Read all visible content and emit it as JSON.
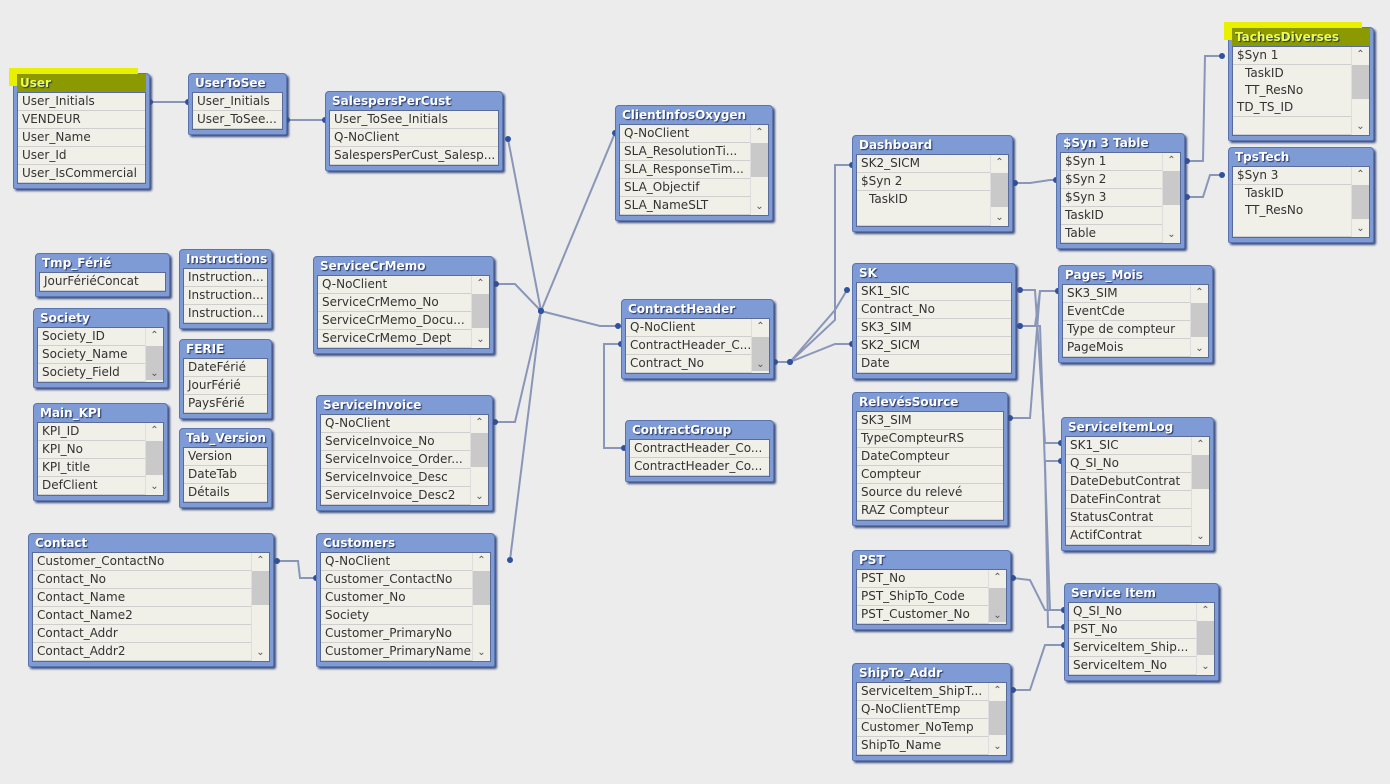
{
  "colors": {
    "header": "#7f9bd6",
    "highlight": "#e8f000",
    "link": "#8a96b8",
    "dot": "#3050a0"
  },
  "tables": [
    {
      "name": "User",
      "highlighted": true,
      "scroll": false,
      "fields": [
        "User_Initials",
        "VENDEUR",
        "User_Name",
        "User_Id",
        "User_IsCommercial"
      ]
    },
    {
      "name": "UserToSee",
      "scroll": false,
      "fields": [
        "User_Initials",
        "User_ToSee..."
      ]
    },
    {
      "name": "SalespersPerCust",
      "scroll": false,
      "fields": [
        "User_ToSee_Initials",
        "Q-NoClient",
        "SalespersPerCust_Salesp..."
      ]
    },
    {
      "name": "ClientInfosOxygen",
      "scroll": true,
      "fields": [
        "Q-NoClient",
        "SLA_ResolutionTi...",
        "SLA_ResponseTim...",
        "SLA_Objectif",
        "SLA_NameSLT"
      ]
    },
    {
      "name": "Dashboard",
      "scroll": true,
      "fields": [
        "SK2_SICM",
        "$Syn 2",
        "  TaskID",
        ""
      ]
    },
    {
      "name": "$Syn 3 Table",
      "scroll": true,
      "fields": [
        "$Syn 1",
        "$Syn 2",
        "$Syn 3",
        "TaskID",
        "Table"
      ]
    },
    {
      "name": "TachesDiverses",
      "highlighted": true,
      "scroll": true,
      "fields": [
        "$Syn 1",
        "  TaskID",
        "  TT_ResNo",
        "TD_TS_ID",
        ""
      ]
    },
    {
      "name": "TpsTech",
      "scroll": true,
      "fields": [
        "$Syn 3",
        "  TaskID",
        "  TT_ResNo",
        ""
      ]
    },
    {
      "name": "Tmp_Férié",
      "scroll": false,
      "fields": [
        "JourFériéConcat"
      ]
    },
    {
      "name": "Instructions",
      "scroll": false,
      "fields": [
        "Instruction...",
        "Instruction...",
        "Instruction..."
      ]
    },
    {
      "name": "Society",
      "scroll": true,
      "fields": [
        "Society_ID",
        "Society_Name",
        "Society_Field"
      ]
    },
    {
      "name": "FERIE",
      "scroll": false,
      "fields": [
        "DateFérié",
        "JourFérié",
        "PaysFérié"
      ]
    },
    {
      "name": "Main_KPI",
      "scroll": true,
      "fields": [
        "KPI_ID",
        "KPI_No",
        "KPI_title",
        "DefClient"
      ]
    },
    {
      "name": "Tab_Version",
      "scroll": false,
      "fields": [
        "Version",
        "DateTab",
        "Détails"
      ]
    },
    {
      "name": "Contact",
      "scroll": true,
      "fields": [
        "Customer_ContactNo",
        "Contact_No",
        "Contact_Name",
        "Contact_Name2",
        "Contact_Addr",
        "Contact_Addr2"
      ]
    },
    {
      "name": "ServiceCrMemo",
      "scroll": true,
      "fields": [
        "Q-NoClient",
        "ServiceCrMemo_No",
        "ServiceCrMemo_Docu...",
        "ServiceCrMemo_Dept"
      ]
    },
    {
      "name": "ServiceInvoice",
      "scroll": true,
      "fields": [
        "Q-NoClient",
        "ServiceInvoice_No",
        "ServiceInvoice_Order...",
        "ServiceInvoice_Desc",
        "ServiceInvoice_Desc2"
      ]
    },
    {
      "name": "Customers",
      "scroll": true,
      "fields": [
        "Q-NoClient",
        "Customer_ContactNo",
        "Customer_No",
        "Society",
        "Customer_PrimaryNo",
        "Customer_PrimaryName"
      ]
    },
    {
      "name": "ContractHeader",
      "scroll": true,
      "fields": [
        "Q-NoClient",
        "ContractHeader_C...",
        "Contract_No"
      ]
    },
    {
      "name": "ContractGroup",
      "scroll": false,
      "fields": [
        "ContractHeader_Co...",
        "ContractHeader_Co..."
      ]
    },
    {
      "name": "SK",
      "scroll": false,
      "fields": [
        "SK1_SIC",
        "Contract_No",
        "SK3_SIM",
        "SK2_SICM",
        "Date"
      ]
    },
    {
      "name": "RelevésSource",
      "scroll": false,
      "fields": [
        "SK3_SIM",
        "TypeCompteurRS",
        "DateCompteur",
        "Compteur",
        "Source du relevé",
        "RAZ Compteur"
      ]
    },
    {
      "name": "Pages_Mois",
      "scroll": true,
      "fields": [
        "SK3_SIM",
        "EventCde",
        "Type de compteur",
        "PageMois"
      ]
    },
    {
      "name": "ServiceItemLog",
      "scroll": true,
      "fields": [
        "SK1_SIC",
        "Q_SI_No",
        "DateDebutContrat",
        "DateFinContrat",
        "StatusContrat",
        "ActifContrat"
      ]
    },
    {
      "name": "PST",
      "scroll": true,
      "fields": [
        "PST_No",
        "PST_ShipTo_Code",
        "PST_Customer_No"
      ]
    },
    {
      "name": "Service Item",
      "scroll": true,
      "fields": [
        "Q_SI_No",
        "PST_No",
        "ServiceItem_Ship...",
        "ServiceItem_No"
      ]
    },
    {
      "name": "ShipTo_Addr",
      "scroll": true,
      "fields": [
        "ServiceItem_ShipT...",
        "Q-NoClientTEmp",
        "Customer_NoTemp",
        "ShipTo_Name"
      ]
    }
  ]
}
